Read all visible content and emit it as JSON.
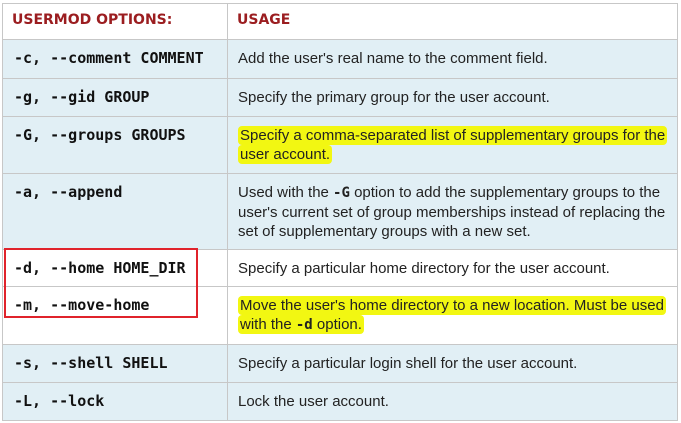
{
  "header": {
    "option_col": "USERMOD OPTIONS:",
    "usage_col": "USAGE"
  },
  "rows": [
    {
      "option": "-c, --comment COMMENT",
      "usage": "Add the user's real name to the comment field."
    },
    {
      "option": "-g, --gid GROUP",
      "usage": "Specify the primary group for the user account."
    },
    {
      "option": "-G, --groups GROUPS",
      "usage": "Specify a comma-separated list of supplementary groups for the user account."
    },
    {
      "option": "-a, --append",
      "usage_pre": "Used with the ",
      "usage_code": "-G",
      "usage_post": " option to add the supplementary groups to the user's current set of group memberships instead of replacing the set of supplementary groups with a new set."
    },
    {
      "option": "-d, --home HOME_DIR",
      "usage": "Specify a particular home directory for the user account."
    },
    {
      "option": "-m, --move-home",
      "usage_pre": "Move the user's home directory to a new location. Must be used with the ",
      "usage_code": "-d",
      "usage_post": " option."
    },
    {
      "option": "-s, --shell SHELL",
      "usage": "Specify a particular login shell for the user account."
    },
    {
      "option": "-L, --lock",
      "usage": "Lock the user account."
    }
  ],
  "colors": {
    "header_text": "#9b1d20",
    "row_alt": "#e1eff5",
    "highlight": "#f2f712",
    "box": "#e0232b"
  }
}
